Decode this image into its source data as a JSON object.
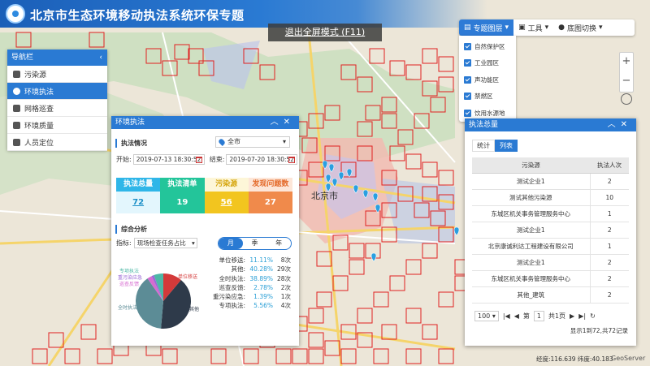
{
  "header": {
    "title": "北京市生态环境移动执法系统环保专题"
  },
  "exit_fullscreen": "退出全屏模式 (F11)",
  "toolbar": {
    "layers": "专题图层",
    "tools": "工具",
    "basemap": "底图切换"
  },
  "layers": [
    "自然保护区",
    "工业园区",
    "声功能区",
    "禁燃区",
    "饮用水源地"
  ],
  "nav": {
    "title": "导航栏",
    "items": [
      "污染源",
      "环境执法",
      "网格巡查",
      "环境质量",
      "人员定位"
    ]
  },
  "enforcement": {
    "title": "环境执法",
    "situation_label": "执法情况",
    "area": "全市",
    "start_label": "开始:",
    "start": "2019-07-13 18:30:52",
    "end_label": "结束:",
    "end": "2019-07-20 18:30:52",
    "kpis": [
      {
        "label": "执法总量",
        "value": "72",
        "color": "#2fb6e8"
      },
      {
        "label": "执法清单",
        "value": "19",
        "color": "#23c59a"
      },
      {
        "label": "污染源",
        "value": "56",
        "color": "#f2c51f"
      },
      {
        "label": "发现问题数",
        "value": "27",
        "color": "#f08a4b"
      }
    ],
    "analysis_label": "综合分析",
    "metric_label": "指标:",
    "metric": "现场检查任务占比",
    "periods": [
      "月",
      "季",
      "年"
    ],
    "pie_labels": [
      "专项执法",
      "重污染应急",
      "巡查反馈",
      "全时执法",
      "单位移送",
      "其他"
    ],
    "stats": [
      {
        "name": "单位移送:",
        "pct": "11.11%",
        "count": "8次",
        "color": "#d43a3a"
      },
      {
        "name": "其他:",
        "pct": "40.28%",
        "count": "29次",
        "color": "#2e3a4a"
      },
      {
        "name": "全时执法:",
        "pct": "38.89%",
        "count": "28次",
        "color": "#5c8c96"
      },
      {
        "name": "巡查反馈:",
        "pct": "2.78%",
        "count": "2次",
        "color": "#d76bd0"
      },
      {
        "name": "重污染应急:",
        "pct": "1.39%",
        "count": "1次",
        "color": "#9b6ad6"
      },
      {
        "name": "专项执法:",
        "pct": "5.56%",
        "count": "4次",
        "color": "#4db8a6"
      }
    ]
  },
  "totals": {
    "title": "执法总量",
    "tabs": [
      "统计",
      "列表"
    ],
    "columns": [
      "污染源",
      "执法人次"
    ],
    "rows": [
      [
        "测试企业1",
        "2"
      ],
      [
        "测试其他污染源",
        "10"
      ],
      [
        "东城区机关事务管理服务中心",
        "1"
      ],
      [
        "测试企业1",
        "2"
      ],
      [
        "北京康诚利达工程建设有限公司",
        "1"
      ],
      [
        "测试企业1",
        "2"
      ],
      [
        "东城区机关事务管理服务中心",
        "2"
      ],
      [
        "其他_建筑",
        "2"
      ]
    ],
    "page_size": "100",
    "page_label": "第",
    "page": "1",
    "page_of": "共1页",
    "record_info": "显示1到72,共72记录"
  },
  "status": {
    "coords": "经度:116.639 纬度:40.183",
    "brand": "GeoServer"
  },
  "map_labels": [
    "北京市"
  ],
  "chart_data": {
    "type": "pie",
    "values": [
      11.11,
      40.28,
      38.89,
      2.78,
      1.39,
      5.56
    ],
    "categories": [
      "单位移送",
      "其他",
      "全时执法",
      "巡查反馈",
      "重污染应急",
      "专项执法"
    ],
    "colors": [
      "#d43a3a",
      "#2e3a4a",
      "#5c8c96",
      "#d76bd0",
      "#9b6ad6",
      "#4db8a6"
    ]
  }
}
